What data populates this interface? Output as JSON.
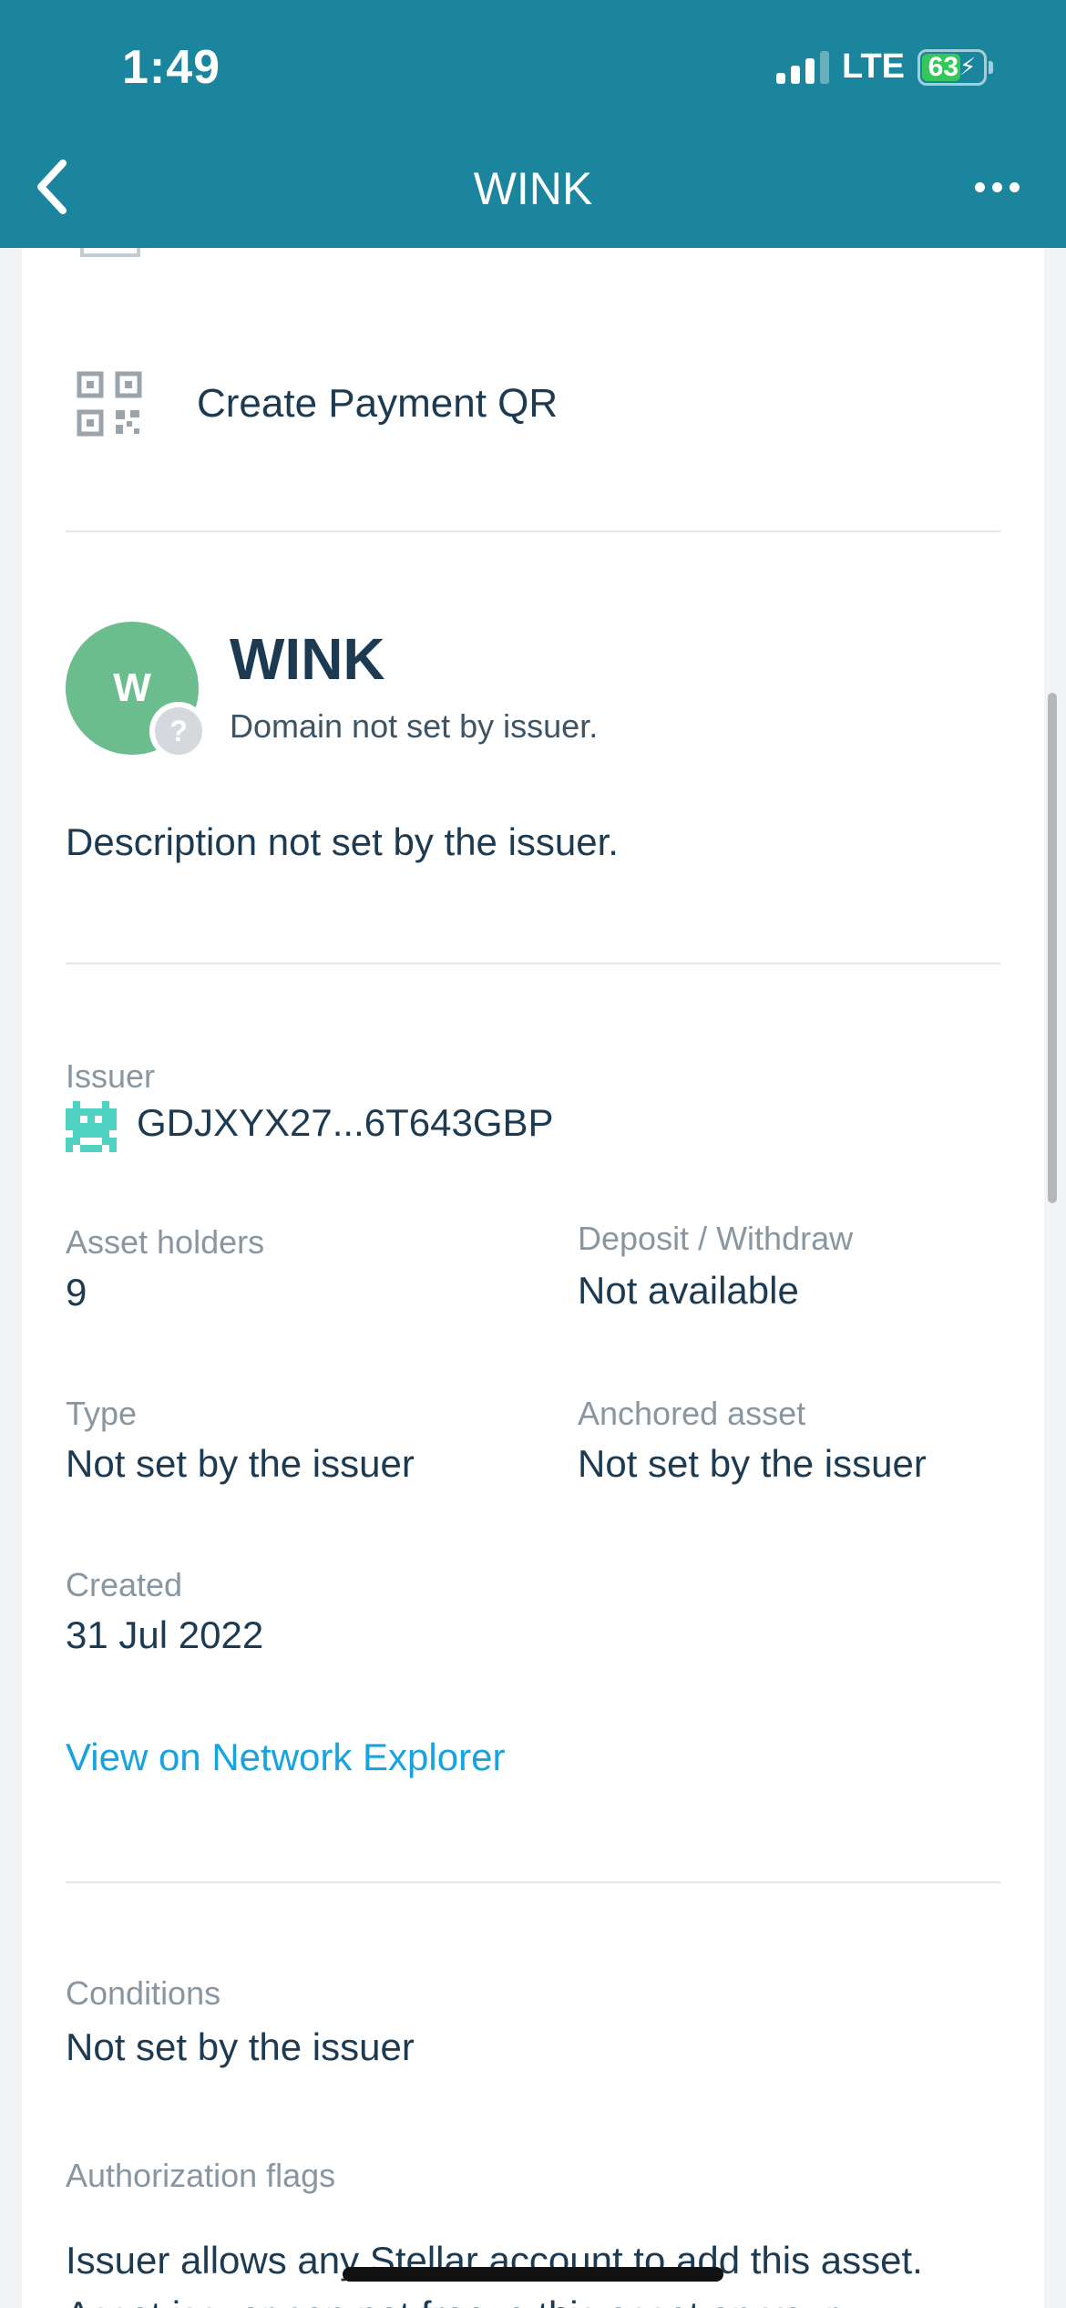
{
  "status_bar": {
    "time": "1:49",
    "network": "LTE",
    "battery": "63",
    "battery_level": 0.63,
    "accent_color": "#34c759"
  },
  "nav": {
    "title": "WINK",
    "back_icon": "chevron-left-icon",
    "more_icon": "more-horizontal-icon",
    "bar_color": "#1a859c"
  },
  "actions": {
    "create_payment_qr": "Create Payment QR",
    "qr_icon": "qr-code-icon"
  },
  "asset": {
    "avatar_letter": "W",
    "avatar_color": "#6bbd8e",
    "code": "WINK",
    "domain": "Domain not set by issuer.",
    "badge": "?",
    "description": "Description not set by the issuer."
  },
  "details": {
    "issuer_label": "Issuer",
    "issuer_value": "GDJXYX27...6T643GBP",
    "holders_label": "Asset holders",
    "holders_value": "9",
    "deposit_label": "Deposit / Withdraw",
    "deposit_value": "Not available",
    "type_label": "Type",
    "type_value": "Not set by the issuer",
    "anchored_label": "Anchored asset",
    "anchored_value": "Not set by the issuer",
    "created_label": "Created",
    "created_value": "31 Jul 2022",
    "explorer_link": "View on Network Explorer",
    "link_color": "#16a3e0"
  },
  "conditions": {
    "label": "Conditions",
    "value": "Not set by the issuer",
    "flags_label": "Authorization flags",
    "flags_line1": "Issuer allows any Stellar account to add this asset.",
    "flags_line2": "Asset issuer can not freeze this asset on your"
  }
}
